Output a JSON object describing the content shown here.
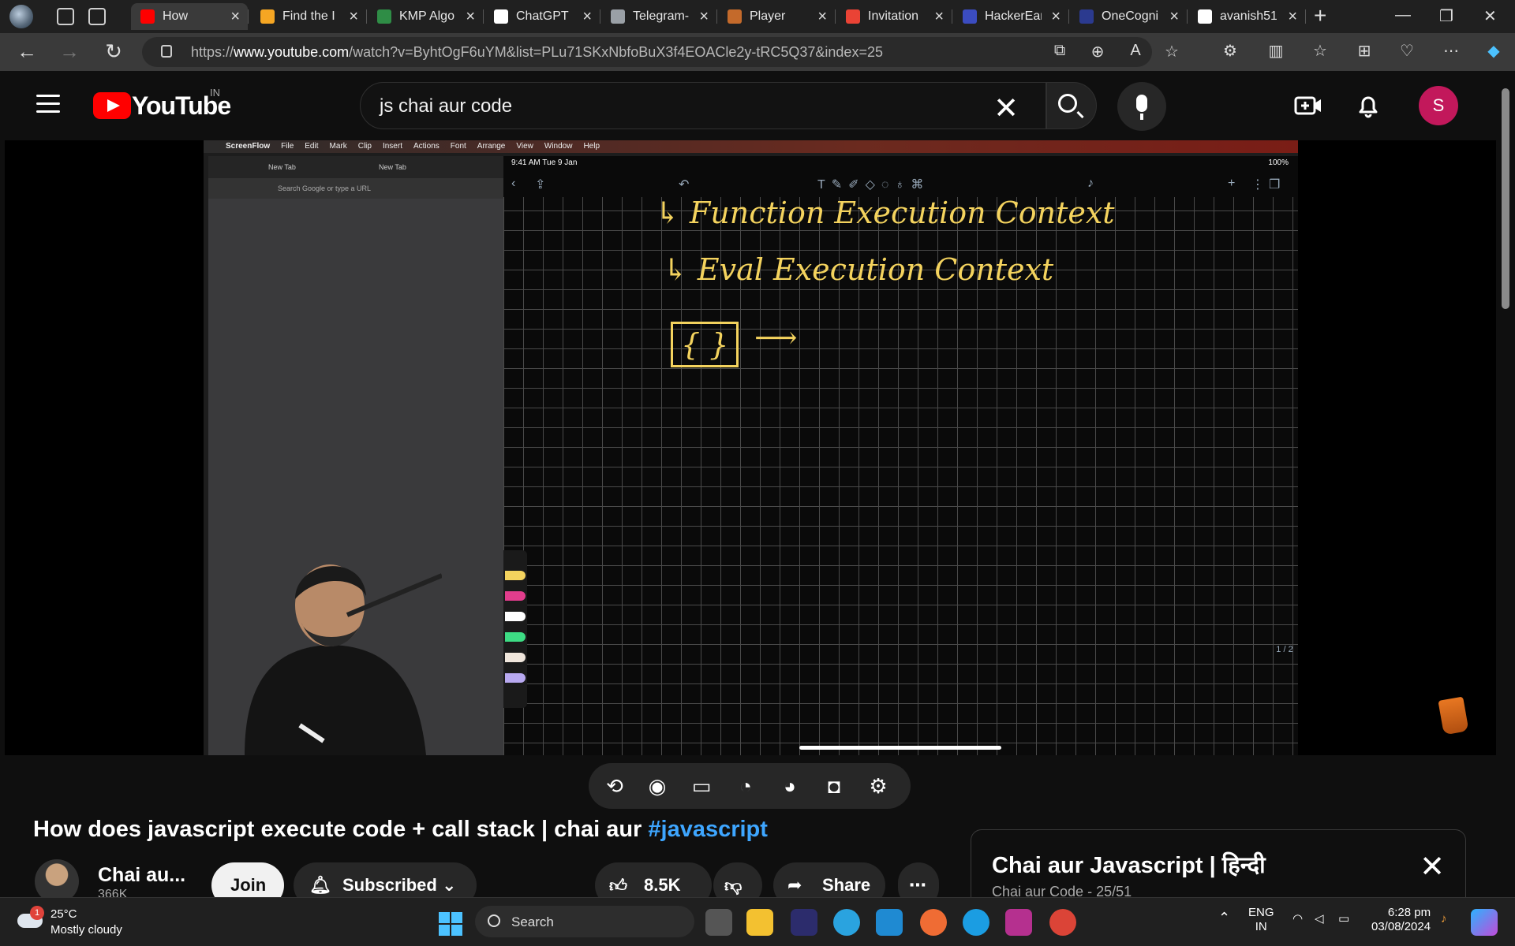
{
  "browser": {
    "tabs": [
      {
        "label": "How",
        "color": "#ff0000",
        "active": true
      },
      {
        "label": "Find the I",
        "color": "#f5a623"
      },
      {
        "label": "KMP Algo",
        "color": "#2f8d46"
      },
      {
        "label": "ChatGPT",
        "color": "#ffffff"
      },
      {
        "label": "Telegram-",
        "color": "#9aa0a6"
      },
      {
        "label": "Player",
        "color": "#c46a2b"
      },
      {
        "label": "Invitation",
        "color": "#ea4335"
      },
      {
        "label": "HackerEar",
        "color": "#3b4cc0"
      },
      {
        "label": "OneCogni",
        "color": "#2b3a8f"
      },
      {
        "label": "avanish51",
        "color": "#ffffff"
      }
    ],
    "url_prefix": "https://",
    "url_host": "www.youtube.com",
    "url_path": "/watch?v=ByhtOgF6uYM&list=PLu71SKxNbfoBuX3f4EOACle2y-tRC5Q37&index=25"
  },
  "youtube": {
    "logo_text": "YouTube",
    "country": "IN",
    "search_query": "js chai aur code",
    "avatar_initial": "S",
    "accent": "#ff0000"
  },
  "video": {
    "mac_menu": [
      "ScreenFlow",
      "File",
      "Edit",
      "Mark",
      "Clip",
      "Insert",
      "Actions",
      "Font",
      "Arrange",
      "View",
      "Window",
      "Help"
    ],
    "chrome_tab1": "New Tab",
    "chrome_tab2": "New Tab",
    "chrome_omnibox": "Search Google or type a URL",
    "ipad_time": "9:41 AM  Tue 9 Jan",
    "ipad_battery": "100%",
    "note_line1": "↳ Function Execution Context",
    "note_line2": "↳ Eval Execution Context",
    "note_braces": "{ }",
    "note_arrow": "⟶",
    "page_indicator": "1 / 2"
  },
  "controls": {
    "icons": [
      "loop-icon",
      "live-icon",
      "aspect-icon",
      "speed-down-icon",
      "speed-up-icon",
      "screenshot-icon",
      "settings-icon"
    ]
  },
  "meta": {
    "title": "How does javascript execute code + call stack | chai aur ",
    "hashtag": "#javascript",
    "channel_name": "Chai au...",
    "channel_subs": "366K",
    "join_label": "Join",
    "subscribed_label": "Subscribed",
    "likes": "8.5K",
    "share_label": "Share"
  },
  "playlist": {
    "title": "Chai aur Javascript | हिन्दी",
    "subtitle": "Chai aur Code - 25/51"
  },
  "taskbar": {
    "temperature": "25°C",
    "condition": "Mostly cloudy",
    "weather_badge": "1",
    "search_label": "Search",
    "lang_top": "ENG",
    "lang_bottom": "IN",
    "time": "6:28 pm",
    "date": "03/08/2024"
  }
}
